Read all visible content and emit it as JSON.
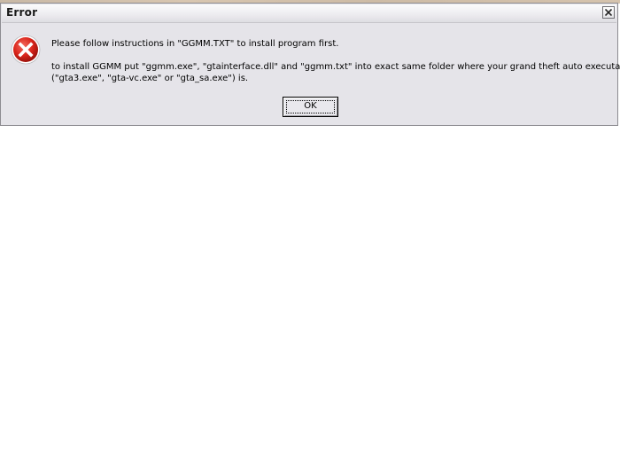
{
  "window": {
    "title": "Error",
    "close_icon": "close-icon"
  },
  "message": {
    "icon": "error-icon",
    "line1": "Please follow instructions in \"GGMM.TXT\" to install program first.",
    "line2a": "to install GGMM put \"ggmm.exe\", \"gtainterface.dll\" and \"ggmm.txt\" into exact same folder where your grand theft auto executable",
    "line2b": "(\"gta3.exe\", \"gta-vc.exe\" or \"gta_sa.exe\") is."
  },
  "buttons": {
    "ok_label": "OK"
  },
  "colors": {
    "dialog_bg": "#e5e4e9",
    "error_red": "#d9241a"
  }
}
